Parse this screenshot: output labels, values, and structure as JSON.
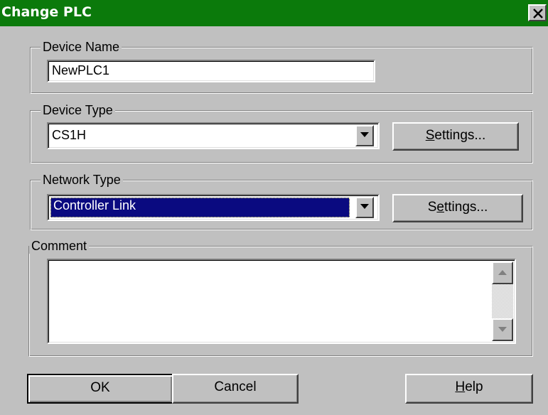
{
  "window": {
    "title": "Change PLC"
  },
  "device_name": {
    "label": "Device Name",
    "value": "NewPLC1"
  },
  "device_type": {
    "label": "Device Type",
    "value": "CS1H",
    "settings_pre": "",
    "settings_ul": "S",
    "settings_post": "ettings..."
  },
  "network_type": {
    "label": "Network Type",
    "value": "Controller Link",
    "settings_pre": "S",
    "settings_ul": "e",
    "settings_post": "ttings..."
  },
  "comment": {
    "label": "Comment",
    "value": ""
  },
  "buttons": {
    "ok": "OK",
    "cancel": "Cancel",
    "help_ul": "H",
    "help_post": "elp"
  },
  "colors": {
    "titlebar": "#0b7a0b",
    "selection": "#0a0a80",
    "face": "#c0c0c0"
  },
  "icons": {
    "close": "close-icon",
    "dropdown": "chevron-down-icon",
    "scroll_up": "scroll-up-arrow-icon",
    "scroll_down": "scroll-down-arrow-icon"
  }
}
